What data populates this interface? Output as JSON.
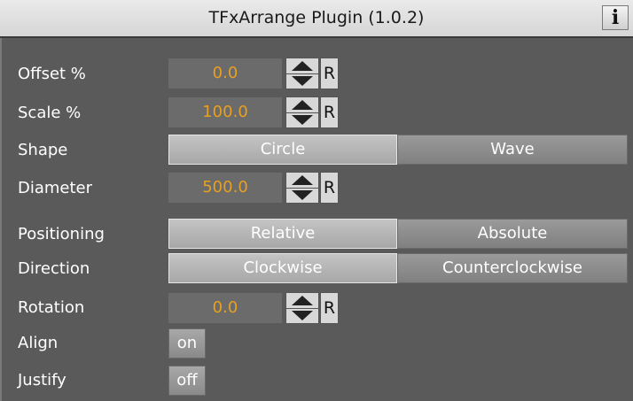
{
  "window": {
    "title": "TFxArrange Plugin (1.0.2)",
    "info_label": "i"
  },
  "rows": {
    "offset": {
      "label": "Offset %",
      "value": "0.0",
      "reset": "R"
    },
    "scale": {
      "label": "Scale %",
      "value": "100.0",
      "reset": "R"
    },
    "shape": {
      "label": "Shape",
      "options": [
        "Circle",
        "Wave"
      ],
      "selected": "Circle"
    },
    "diameter": {
      "label": "Diameter",
      "value": "500.0",
      "reset": "R"
    },
    "positioning": {
      "label": "Positioning",
      "options": [
        "Relative",
        "Absolute"
      ],
      "selected": "Relative"
    },
    "direction": {
      "label": "Direction",
      "options": [
        "Clockwise",
        "Counterclockwise"
      ],
      "selected": "Clockwise"
    },
    "rotation": {
      "label": "Rotation",
      "value": "0.0",
      "reset": "R"
    },
    "align": {
      "label": "Align",
      "value": "on"
    },
    "justify": {
      "label": "Justify",
      "value": "off"
    }
  },
  "colors": {
    "panel_bg": "#5a5a5a",
    "value_text": "#e8a020",
    "label_text": "#ffffff"
  },
  "icons": {
    "stepper": "up-down-arrows-icon",
    "info": "info-icon"
  }
}
